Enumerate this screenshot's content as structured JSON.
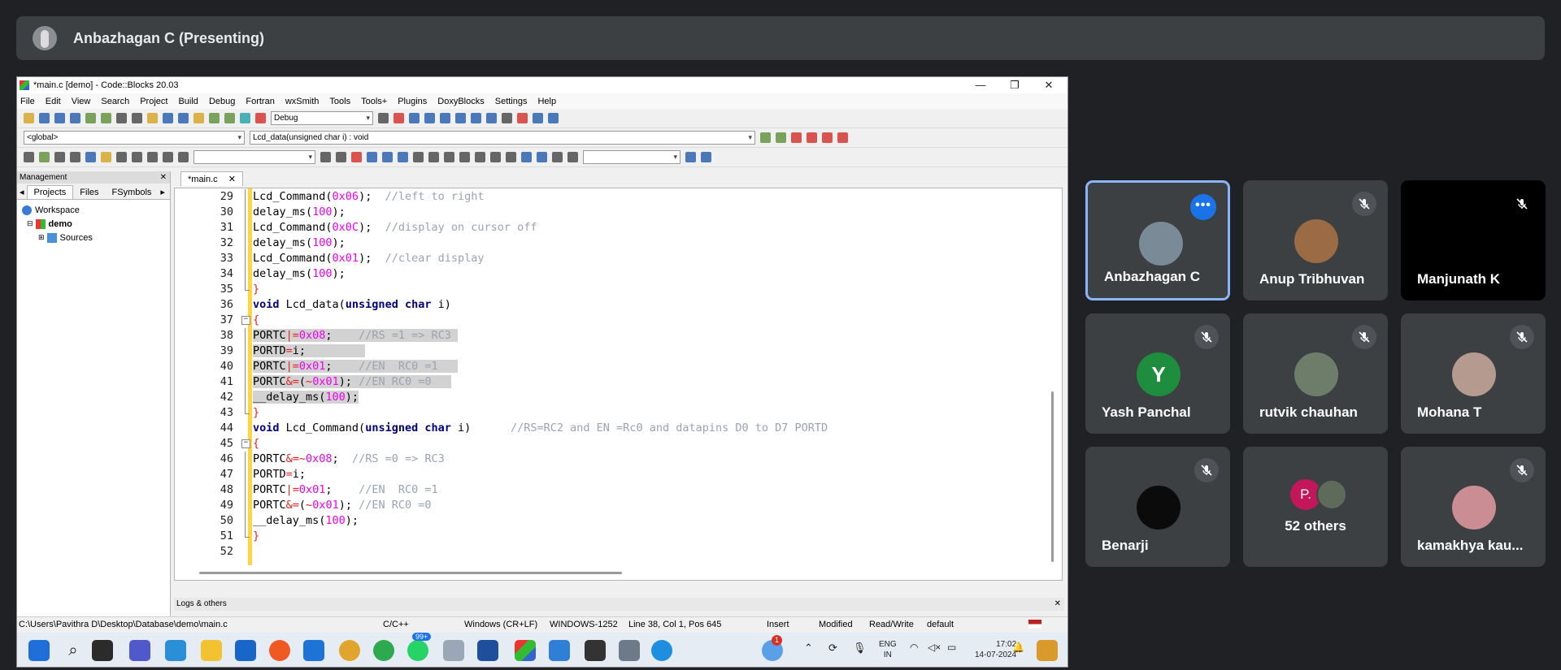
{
  "presenter_bar": {
    "name": "Anbazhagan C (Presenting)"
  },
  "codeblocks": {
    "title": "*main.c [demo] - Code::Blocks 20.03",
    "menu": [
      "File",
      "Edit",
      "View",
      "Search",
      "Project",
      "Build",
      "Debug",
      "Fortran",
      "wxSmith",
      "Tools",
      "Tools+",
      "Plugins",
      "DoxyBlocks",
      "Settings",
      "Help"
    ],
    "build_target": "Debug",
    "scope_combo": "<global>",
    "function_combo": "Lcd_data(unsigned char i) : void",
    "management": {
      "title": "Management",
      "tabs": [
        "Projects",
        "Files",
        "FSymbols"
      ],
      "tree": [
        "Workspace",
        "demo",
        "Sources"
      ]
    },
    "file_tab": "*main.c",
    "code_lines": [
      {
        "n": "29",
        "html": "Lcd_Command(<span class=\"num\">0x06</span>);  <span class=\"cm\">//left to right</span>"
      },
      {
        "n": "30",
        "html": "delay_ms(<span class=\"num\">100</span>);"
      },
      {
        "n": "31",
        "html": "Lcd_Command(<span class=\"num\">0x0C</span>);  <span class=\"cm\">//display on cursor off</span>"
      },
      {
        "n": "32",
        "html": "delay_ms(<span class=\"num\">100</span>);"
      },
      {
        "n": "33",
        "html": "Lcd_Command(<span class=\"num\">0x01</span>);  <span class=\"cm\">//clear display</span>"
      },
      {
        "n": "34",
        "html": "delay_ms(<span class=\"num\">100</span>);"
      },
      {
        "n": "35",
        "html": "<span class=\"op\">}</span>"
      },
      {
        "n": "36",
        "html": "<span class=\"kw\">void</span> Lcd_data(<span class=\"kw\">unsigned char</span> i)"
      },
      {
        "n": "37",
        "html": "<span class=\"op\">{</span>"
      },
      {
        "n": "38",
        "html": "<span class=\"sel\">PORTC<span class=\"op\">|=</span><span class=\"num\">0x08</span>;    <span class=\"cm\">//RS =1 =&gt; RC3</span> </span>"
      },
      {
        "n": "39",
        "html": "<span class=\"sel\">PORTD<span class=\"op\">=</span>i;         </span>"
      },
      {
        "n": "40",
        "html": "<span class=\"sel\">PORTC<span class=\"op\">|=</span><span class=\"num\">0x01</span>;    <span class=\"cm\">//EN  RC0 =1</span>   </span>"
      },
      {
        "n": "41",
        "html": "<span class=\"sel\">PORTC<span class=\"op\">&amp;=</span>(<span class=\"op\">~</span><span class=\"num\">0x01</span>); <span class=\"cm\">//EN RC0 =0</span>   </span>"
      },
      {
        "n": "42",
        "html": "<span class=\"sel\">__delay_ms(<span class=\"num\">100</span>);</span>"
      },
      {
        "n": "43",
        "html": "<span class=\"op\">}</span>"
      },
      {
        "n": "44",
        "html": "<span class=\"kw\">void</span> Lcd_Command(<span class=\"kw\">unsigned char</span> i)      <span class=\"cm\">//RS=RC2 and EN =Rc0 and datapins D0 to D7 PORTD</span>"
      },
      {
        "n": "45",
        "html": "<span class=\"op\">{</span>"
      },
      {
        "n": "46",
        "html": "PORTC<span class=\"op\">&amp;=~</span><span class=\"num\">0x08</span>;  <span class=\"cm\">//RS =0 =&gt; RC3</span>"
      },
      {
        "n": "47",
        "html": "PORTD<span class=\"op\">=</span>i;"
      },
      {
        "n": "48",
        "html": "PORTC<span class=\"op\">|=</span><span class=\"num\">0x01</span>;    <span class=\"cm\">//EN  RC0 =1</span>"
      },
      {
        "n": "49",
        "html": "PORTC<span class=\"op\">&amp;=</span>(<span class=\"op\">~</span><span class=\"num\">0x01</span>); <span class=\"cm\">//EN RC0 =0</span>"
      },
      {
        "n": "50",
        "html": "__delay_ms(<span class=\"num\">100</span>);"
      },
      {
        "n": "51",
        "html": "<span class=\"op\">}</span>"
      },
      {
        "n": "52",
        "html": ""
      }
    ],
    "logs_title": "Logs & others",
    "status": {
      "path": "C:\\Users\\Pavithra D\\Desktop\\Database\\demo\\main.c",
      "lang": "C/C++",
      "eol": "Windows (CR+LF)",
      "encoding": "WINDOWS-1252",
      "position": "Line 38, Col 1, Pos 645",
      "mode": "Insert",
      "modified": "Modified",
      "access": "Read/Write",
      "profile": "default"
    },
    "taskbar": {
      "whatsapp_badge": "99+",
      "notification_badge": "1",
      "lang": "ENG",
      "region": "IN",
      "time": "17:02",
      "date": "14-07-2024"
    }
  },
  "participants": [
    {
      "name": "Anbazhagan C",
      "avatar_color": "#7a8a96",
      "speaking": true
    },
    {
      "name": "Anup Tribhuvan",
      "avatar_color": "#9a6b45",
      "muted": true
    },
    {
      "name": "Manjunath K",
      "muted": true
    },
    {
      "name": "Yash Panchal",
      "letter": "Y",
      "avatar_color": "#1e8e3e",
      "muted": true
    },
    {
      "name": "rutvik chauhan",
      "avatar_color": "#6e7d6a",
      "muted": true
    },
    {
      "name": "Mohana T",
      "avatar_color": "#b59a90",
      "muted": true
    },
    {
      "name": "Benarji",
      "avatar_color": "#0b0b0b",
      "muted": true
    },
    {
      "name": "52 others",
      "letter": "P.",
      "avatar_color": "#c2185b"
    },
    {
      "name": "kamakhya kau...",
      "avatar_color": "#c98d93",
      "muted": true
    }
  ]
}
